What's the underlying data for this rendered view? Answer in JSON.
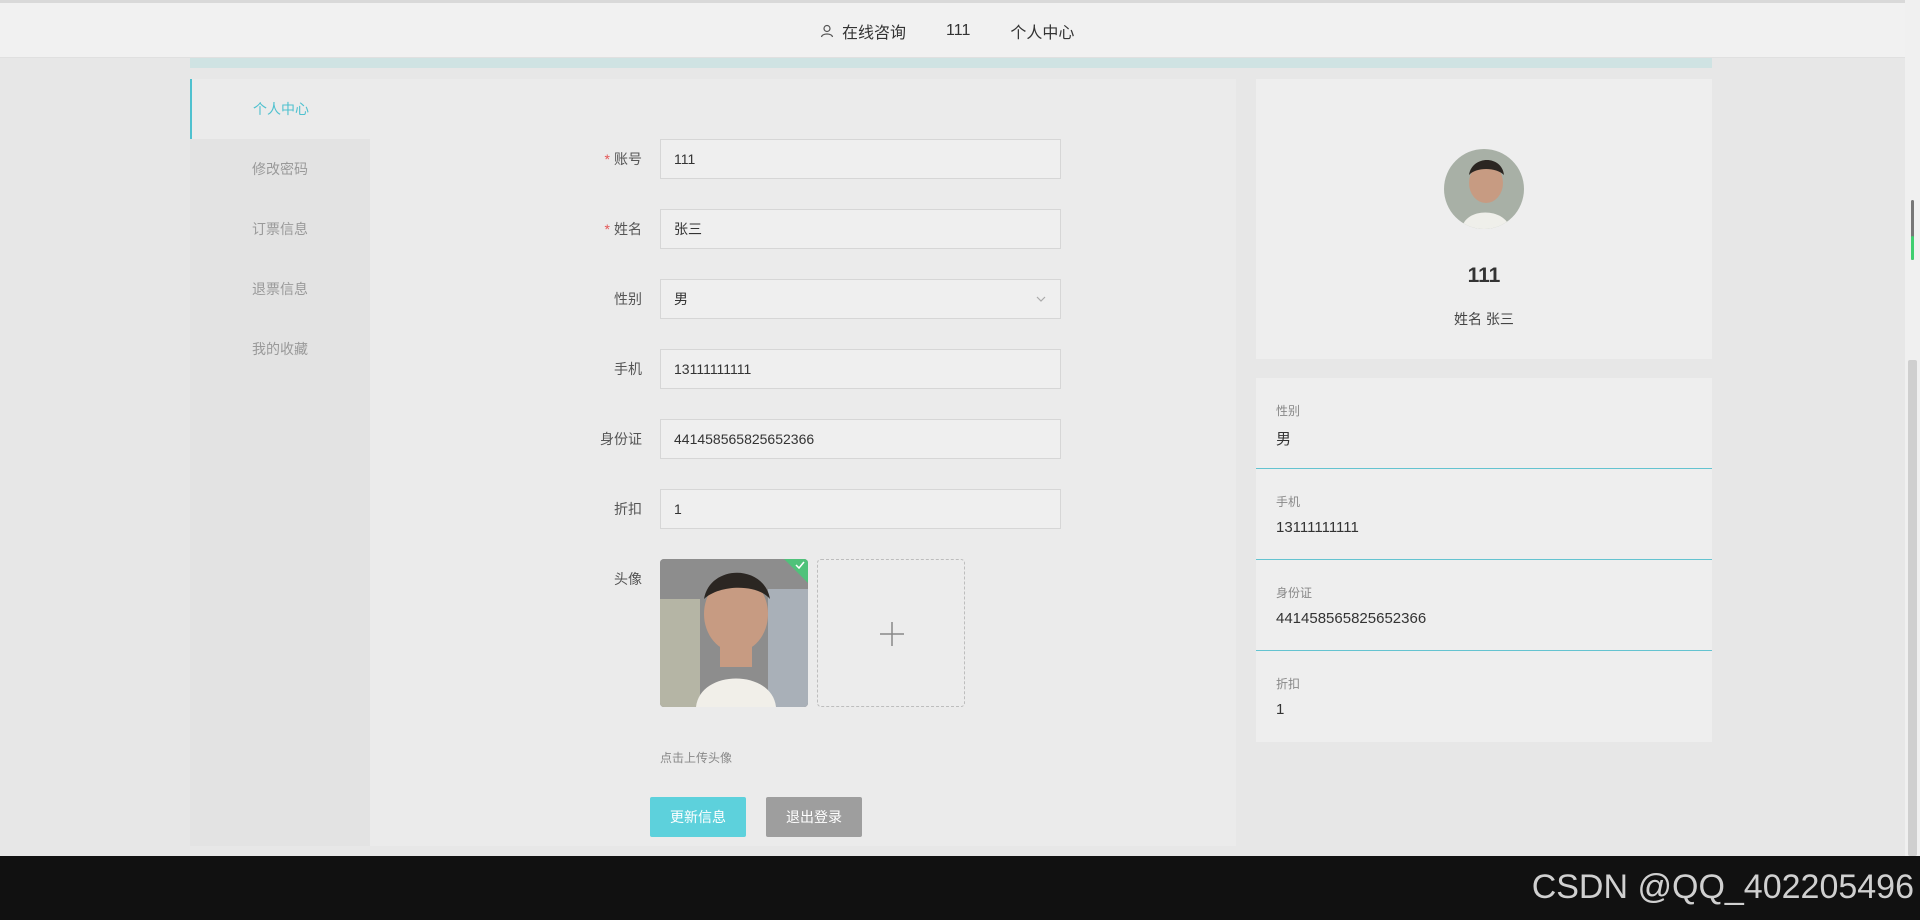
{
  "topnav": {
    "consult": "在线咨询",
    "account": "111",
    "center": "个人中心"
  },
  "sidebar": {
    "items": [
      {
        "label": "个人中心",
        "active": true
      },
      {
        "label": "修改密码"
      },
      {
        "label": "订票信息"
      },
      {
        "label": "退票信息"
      },
      {
        "label": "我的收藏"
      }
    ]
  },
  "form": {
    "account": {
      "label": "账号",
      "value": "111",
      "required": true
    },
    "name": {
      "label": "姓名",
      "value": "张三",
      "required": true
    },
    "gender": {
      "label": "性别",
      "value": "男"
    },
    "phone": {
      "label": "手机",
      "value": "13111111111"
    },
    "idcard": {
      "label": "身份证",
      "value": "441458565825652366"
    },
    "discount": {
      "label": "折扣",
      "value": "1"
    },
    "avatar": {
      "label": "头像",
      "upload_tip": "点击上传头像"
    },
    "update_button": "更新信息",
    "logout_button": "退出登录"
  },
  "profile": {
    "account": "111",
    "name_line": "姓名 张三"
  },
  "info": [
    {
      "label": "性别",
      "value": "男"
    },
    {
      "label": "手机",
      "value": "13111111111"
    },
    {
      "label": "身份证",
      "value": "441458565825652366"
    },
    {
      "label": "折扣",
      "value": "1"
    }
  ],
  "watermark": "CSDN @QQ_402205496",
  "colors": {
    "accent": "#4fc1cf",
    "update_button": "#5dd1dc",
    "logout_button": "#9e9e9e",
    "required": "#e45656"
  }
}
